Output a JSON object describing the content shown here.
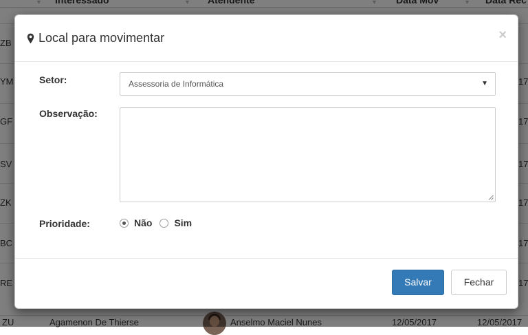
{
  "background": {
    "header": {
      "col_interessado": "Interessado",
      "col_atendente": "Atendente",
      "col_data_mov": "Data Mov",
      "col_data_rec": "Data Rec"
    },
    "row_codes": [
      "ZB",
      "YM",
      "GF",
      "SV",
      "ZK",
      "BC",
      "RE"
    ],
    "row_date_fragment": "17",
    "last_row": {
      "code": "ZU",
      "interessado": "Agamenon De Thierse",
      "atendente": "Anselmo Maciel Nunes",
      "data_mov": "12/05/2017",
      "data_rec": "12/05/2017"
    }
  },
  "modal": {
    "title": "Local para movimentar",
    "close_symbol": "×",
    "fields": {
      "setor_label": "Setor:",
      "setor_value": "Assessoria de Informática",
      "observacao_label": "Observação:",
      "observacao_value": "",
      "prioridade_label": "Prioridade:",
      "prioridade_options": [
        "Não",
        "Sim"
      ],
      "prioridade_selected": "Não"
    },
    "footer": {
      "save_label": "Salvar",
      "close_label": "Fechar"
    }
  },
  "colors": {
    "primary": "#337ab7",
    "backdrop": "rgba(0,0,0,0.5)"
  }
}
